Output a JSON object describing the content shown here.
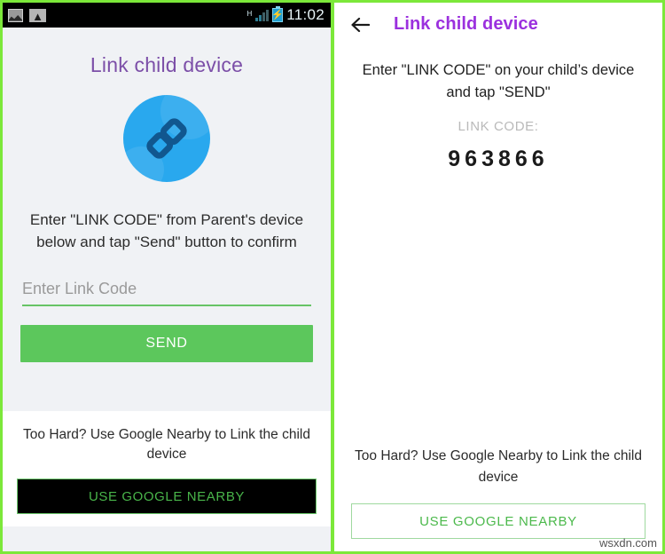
{
  "left_screen": {
    "status_bar": {
      "time": "11:02",
      "network_type": "H",
      "icons": [
        "image-icon",
        "wifi-icon",
        "signal-icon",
        "battery-charging-icon"
      ]
    },
    "title": "Link child device",
    "icon_name": "chain-link-icon",
    "description": "Enter \"LINK CODE\" from Parent's device below and tap \"Send\" button to confirm",
    "input": {
      "placeholder": "Enter Link Code",
      "value": ""
    },
    "send_button": "SEND",
    "nearby_prompt": "Too Hard? Use Google Nearby to Link the child device",
    "nearby_button": "USE GOOGLE NEARBY"
  },
  "right_screen": {
    "back_icon": "back-arrow-icon",
    "title": "Link child device",
    "description": "Enter \"LINK CODE\" on your child’s device and tap \"SEND\"",
    "code_label": "LINK CODE:",
    "code_value": "963866",
    "nearby_prompt": "Too Hard? Use Google Nearby to Link the child device",
    "nearby_button": "USE GOOGLE NEARBY"
  },
  "watermark": "wsxdn.com",
  "colors": {
    "divider_green": "#7ce83a",
    "send_green": "#5cc75c",
    "title_purple_left": "#7c4fa8",
    "title_purple_right": "#9b30de",
    "link_circle_blue": "#29a8ee",
    "panel_gray": "#f0f2f5"
  }
}
